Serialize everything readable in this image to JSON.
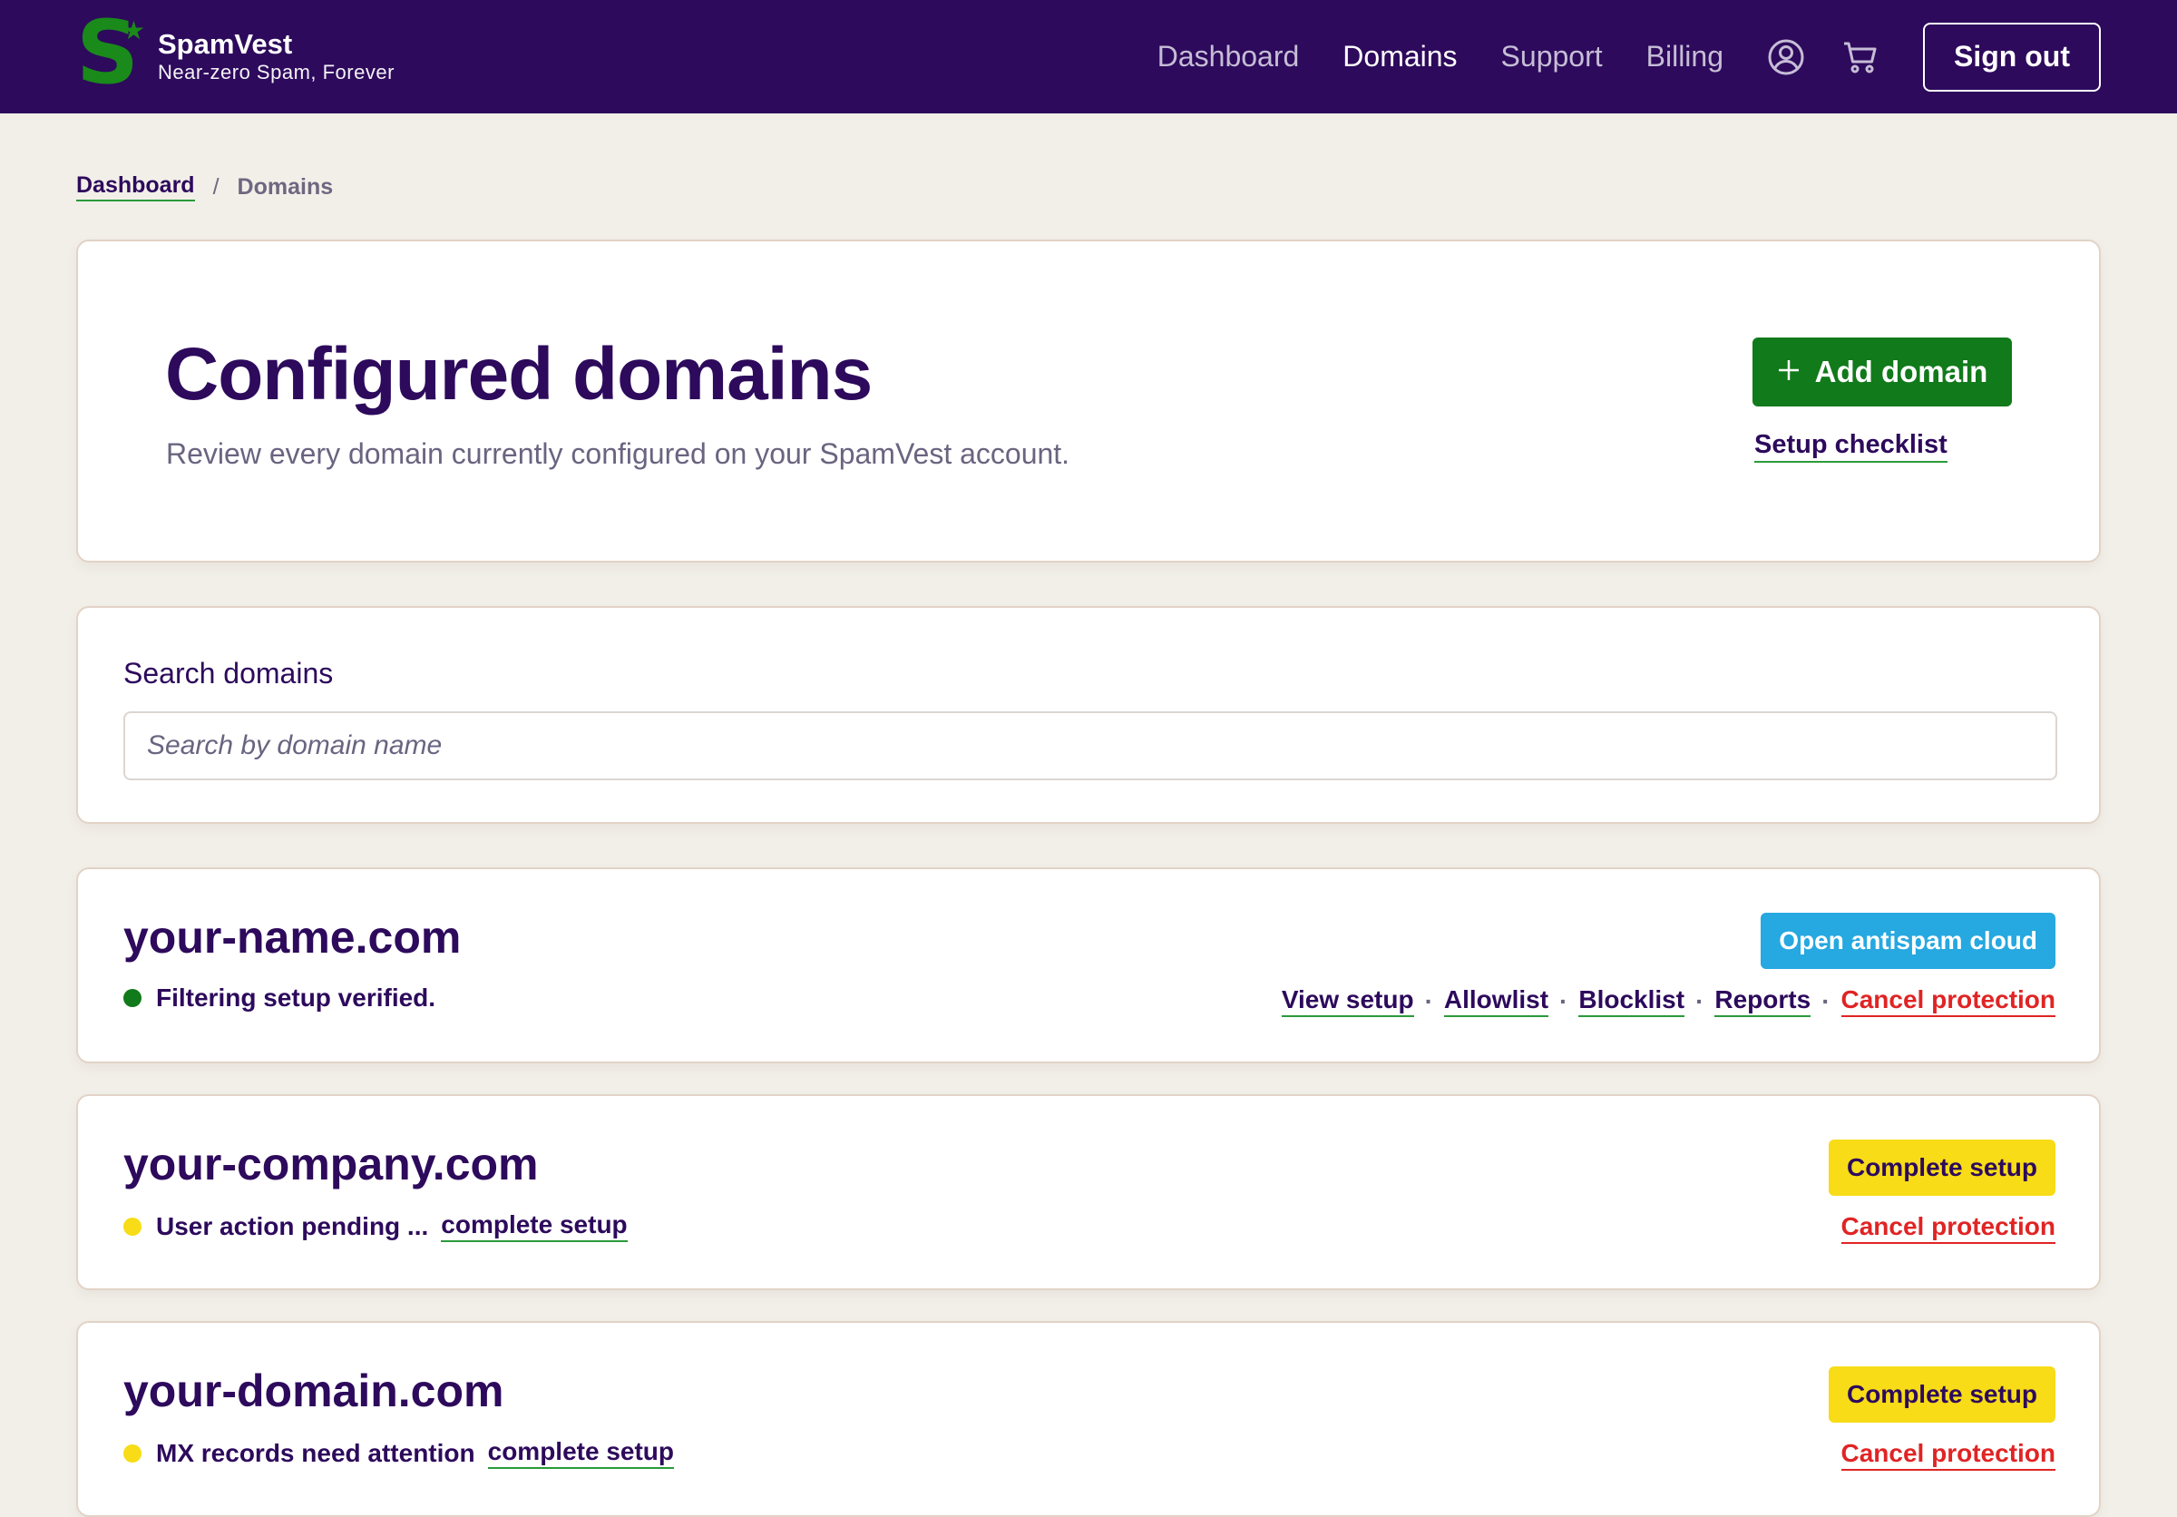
{
  "brand": {
    "name": "SpamVest",
    "tagline": "Near-zero Spam, Forever",
    "logo_letter": "S",
    "logo_star": "★",
    "accent": "#1a8a1a"
  },
  "nav": {
    "items": [
      {
        "label": "Dashboard",
        "active": false
      },
      {
        "label": "Domains",
        "active": true
      },
      {
        "label": "Support",
        "active": false
      },
      {
        "label": "Billing",
        "active": false
      }
    ],
    "account_icon": "user-circle-icon",
    "cart_icon": "shopping-cart-icon",
    "sign_out": "Sign out"
  },
  "breadcrumb": {
    "parent": "Dashboard",
    "separator": "/",
    "current": "Domains"
  },
  "header": {
    "title": "Configured domains",
    "subtitle": "Review every domain currently configured on your SpamVest account.",
    "add_button": "Add domain",
    "add_icon": "+",
    "setup_checklist": "Setup checklist"
  },
  "search": {
    "label": "Search domains",
    "placeholder": "Search by domain name",
    "value": ""
  },
  "domains": [
    {
      "name": "your-name.com",
      "status": "Filtering setup verified.",
      "status_color": "#117a1a",
      "primary_action": "Open antispam cloud",
      "links": {
        "view_setup": "View setup",
        "allowlist": "Allowlist",
        "blocklist": "Blocklist",
        "reports": "Reports",
        "separator": "·",
        "cancel": "Cancel protection"
      }
    },
    {
      "name": "your-company.com",
      "status": "User action pending ...",
      "status_link": "complete setup",
      "status_color": "#f7dc17",
      "primary_action": "Complete setup",
      "cancel": "Cancel protection"
    },
    {
      "name": "your-domain.com",
      "status": "MX records need attention",
      "status_link": "complete setup",
      "status_color": "#f7dc17",
      "primary_action": "Complete setup",
      "cancel": "Cancel protection"
    }
  ],
  "colors": {
    "header_bg": "#2d0a5c",
    "page_bg": "#f2efe9",
    "primary_green": "#117a1a",
    "cloud_blue": "#26a8e0",
    "warning_yellow": "#f7dc17",
    "danger_red": "#e02424"
  }
}
